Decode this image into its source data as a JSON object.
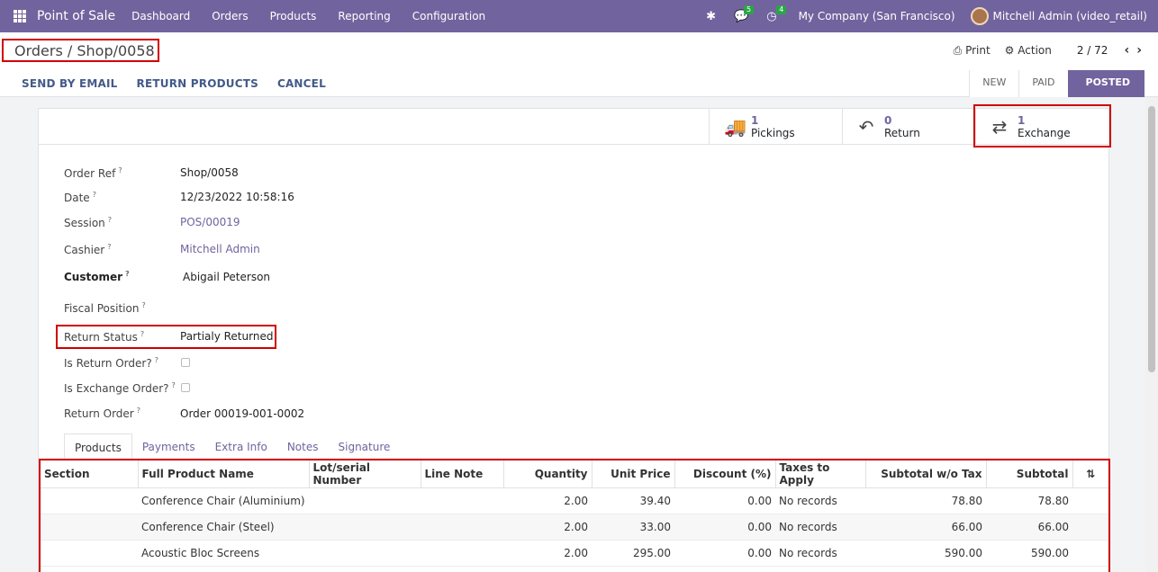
{
  "navbar": {
    "app_name": "Point of Sale",
    "menu": [
      "Dashboard",
      "Orders",
      "Products",
      "Reporting",
      "Configuration"
    ],
    "chat_badge": "5",
    "activity_badge": "4",
    "company": "My Company (San Francisco)",
    "user": "Mitchell Admin (video_retail)"
  },
  "control_panel": {
    "breadcrumb": "Orders / Shop/0058",
    "print_label": "Print",
    "action_label": "Action",
    "pager": "2 / 72",
    "actions": [
      "SEND BY EMAIL",
      "RETURN PRODUCTS",
      "CANCEL"
    ],
    "stages": [
      "NEW",
      "PAID",
      "POSTED"
    ],
    "active_stage": "POSTED"
  },
  "smart_buttons": [
    {
      "count": "1",
      "label": "Pickings",
      "icon": "truck-icon"
    },
    {
      "count": "0",
      "label": "Return",
      "icon": "reply-icon"
    },
    {
      "count": "1",
      "label": "Exchange",
      "icon": "exchange-icon"
    }
  ],
  "fields": {
    "order_ref": {
      "label": "Order Ref",
      "value": "Shop/0058"
    },
    "date": {
      "label": "Date",
      "value": "12/23/2022 10:58:16"
    },
    "session": {
      "label": "Session",
      "value": "POS/00019"
    },
    "cashier": {
      "label": "Cashier",
      "value": "Mitchell Admin"
    },
    "customer": {
      "label": "Customer",
      "value": "Abigail Peterson"
    },
    "fiscal_position": {
      "label": "Fiscal Position",
      "value": ""
    },
    "return_status": {
      "label": "Return Status",
      "value": "Partialy Returned"
    },
    "is_return": {
      "label": "Is Return Order?"
    },
    "is_exchange": {
      "label": "Is Exchange Order?"
    },
    "return_order": {
      "label": "Return Order",
      "value": "Order 00019-001-0002"
    }
  },
  "tabs": [
    "Products",
    "Payments",
    "Extra Info",
    "Notes",
    "Signature"
  ],
  "table": {
    "columns": [
      "Section",
      "Full Product Name",
      "Lot/serial Number",
      "Line Note",
      "Quantity",
      "Unit Price",
      "Discount (%)",
      "Taxes to Apply",
      "Subtotal w/o Tax",
      "Subtotal"
    ],
    "rows": [
      [
        "",
        "Conference Chair (Aluminium)",
        "",
        "",
        "2.00",
        "39.40",
        "0.00",
        "No records",
        "78.80",
        "78.80"
      ],
      [
        "",
        "Conference Chair (Steel)",
        "",
        "",
        "2.00",
        "33.00",
        "0.00",
        "No records",
        "66.00",
        "66.00"
      ],
      [
        "",
        "Acoustic Bloc Screens",
        "",
        "",
        "2.00",
        "295.00",
        "0.00",
        "No records",
        "590.00",
        "590.00"
      ]
    ]
  }
}
